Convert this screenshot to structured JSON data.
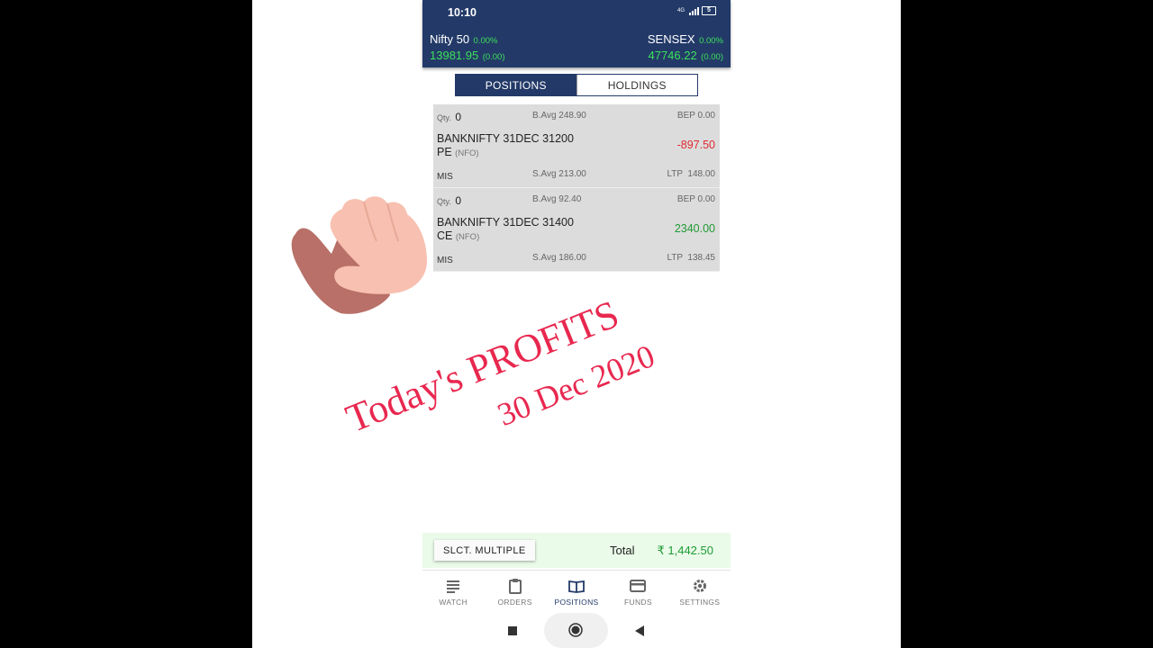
{
  "status_bar": {
    "time": "10:10",
    "network": "4G",
    "battery": "5"
  },
  "indices": [
    {
      "name": "Nifty 50",
      "change_pct": "0.00%",
      "value": "13981.95",
      "change": "(0.00)"
    },
    {
      "name": "SENSEX",
      "change_pct": "0.00%",
      "value": "47746.22",
      "change": "(0.00)"
    }
  ],
  "tabs": [
    {
      "label": "POSITIONS",
      "active": true
    },
    {
      "label": "HOLDINGS",
      "active": false
    }
  ],
  "positions": [
    {
      "qty_label": "Qty.",
      "qty": "0",
      "b_avg": "B.Avg 248.90",
      "bep": "BEP 0.00",
      "symbol": "BANKNIFTY 31DEC 31200 PE",
      "exchange": "(NFO)",
      "pnl": "-897.50",
      "pnl_sign": "negative",
      "product": "MIS",
      "s_avg": "S.Avg 213.00",
      "ltp": "LTP  148.00"
    },
    {
      "qty_label": "Qty.",
      "qty": "0",
      "b_avg": "B.Avg 92.40",
      "bep": "BEP 0.00",
      "symbol": "BANKNIFTY 31DEC 31400 CE",
      "exchange": "(NFO)",
      "pnl": "2340.00",
      "pnl_sign": "positive",
      "product": "MIS",
      "s_avg": "S.Avg 186.00",
      "ltp": "LTP  138.45"
    }
  ],
  "bottom_bar": {
    "select_multiple": "SLCT. MULTIPLE",
    "total_label": "Total",
    "total_value": "₹ 1,442.50"
  },
  "nav": [
    {
      "label": "WATCH",
      "icon": "list-icon"
    },
    {
      "label": "ORDERS",
      "icon": "clipboard-icon"
    },
    {
      "label": "POSITIONS",
      "icon": "book-icon",
      "active": true
    },
    {
      "label": "FUNDS",
      "icon": "card-icon"
    },
    {
      "label": "SETTINGS",
      "icon": "gear-icon"
    }
  ],
  "overlay": {
    "line1": "Today's PROFITS",
    "line2": "30 Dec 2020",
    "color": "#e8284f"
  },
  "colors": {
    "header": "#233a68",
    "positive": "#1f9b34",
    "negative": "#e0282e",
    "index_green": "#3ce05a"
  }
}
